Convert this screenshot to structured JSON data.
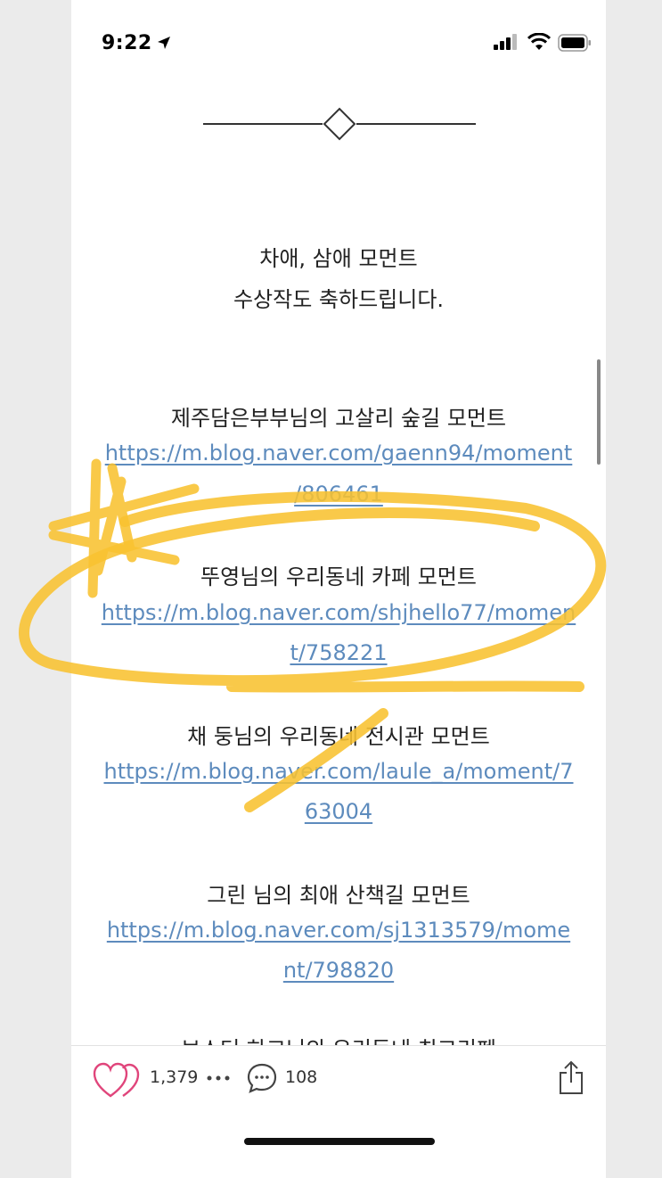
{
  "status_bar": {
    "time": "9:22"
  },
  "post": {
    "intro_lines": [
      "차애, 삼애 모먼트",
      "수상작도 축하드립니다."
    ],
    "entries": [
      {
        "title": "제주담은부부님의 고살리 숲길 모먼트",
        "link_lines": [
          "https://m.blog.naver.com/gaenn94/moment",
          "/806461"
        ]
      },
      {
        "title": "뚜영님의 우리동네 카페 모먼트",
        "link_lines": [
          "https://m.blog.naver.com/shjhello77/momen",
          "t/758221"
        ]
      },
      {
        "title": "채 둥님의 우리동네 전시관 모먼트",
        "link_lines": [
          "https://m.blog.naver.com/laule_a/moment/7",
          "63004"
        ]
      },
      {
        "title": "그린 님의 최애 산책길 모먼트",
        "link_lines": [
          "https://m.blog.naver.com/sj1313579/mome",
          "nt/798820"
        ]
      }
    ],
    "partial_next_title": "보스터 하고님의 우리동네 최고리펜"
  },
  "toolbar": {
    "like_count": "1,379",
    "comment_count": "108"
  },
  "colors": {
    "link": "#5d8bbd",
    "like_heart": "#e0457b",
    "highlighter": "#f8c230"
  }
}
